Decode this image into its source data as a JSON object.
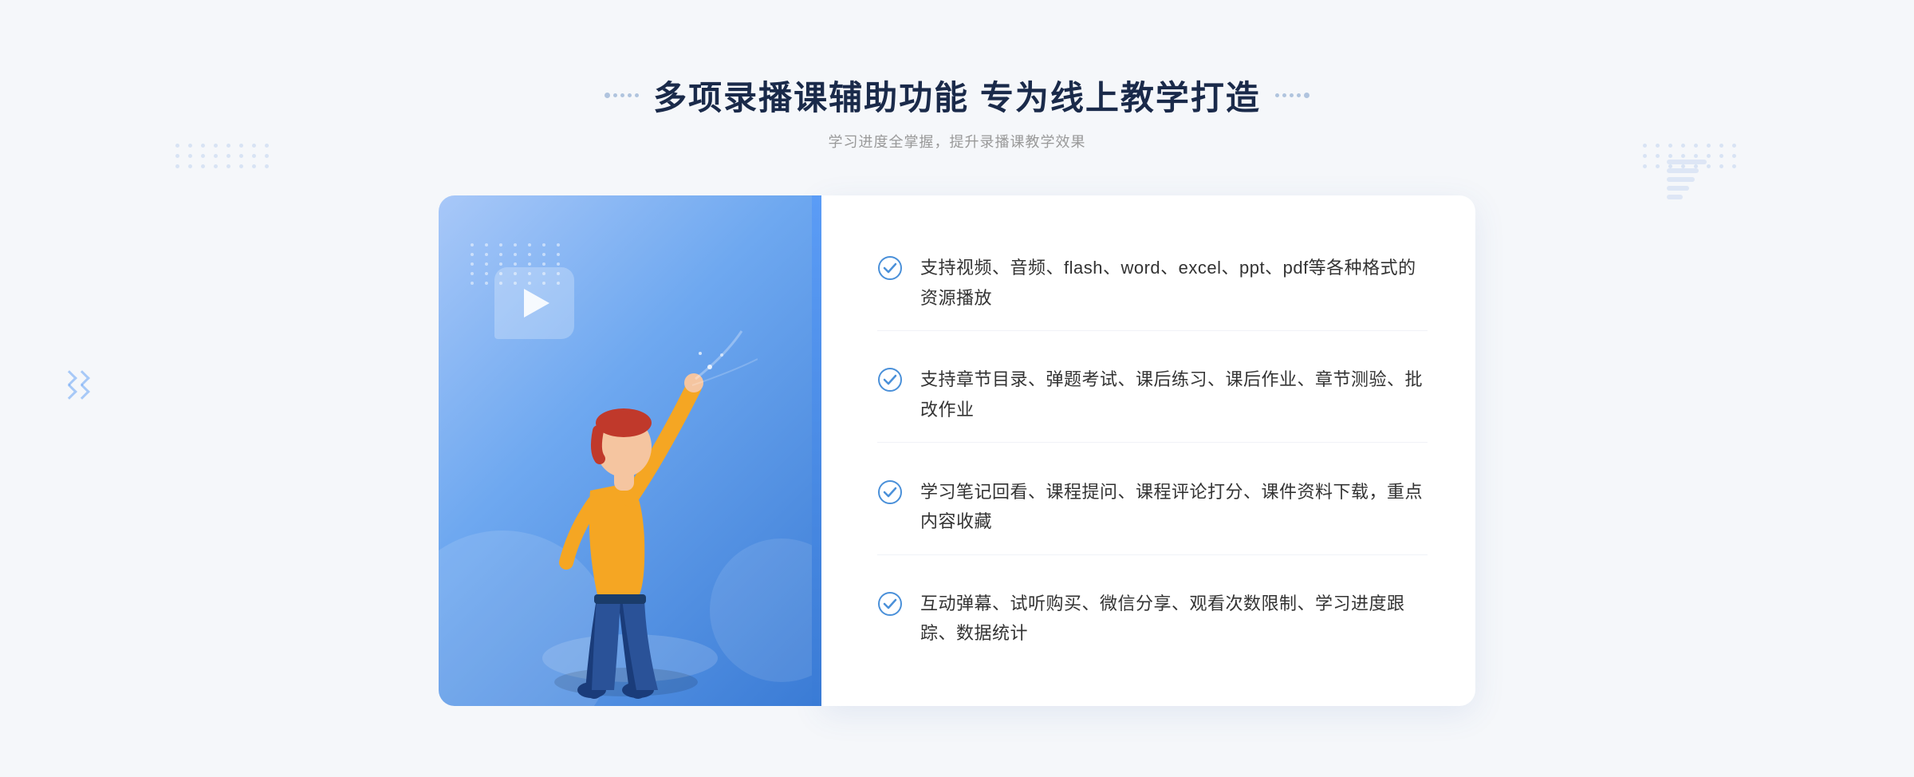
{
  "header": {
    "title": "多项录播课辅助功能 专为线上教学打造",
    "subtitle": "学习进度全掌握，提升录播课教学效果"
  },
  "features": [
    {
      "id": "feature-1",
      "text": "支持视频、音频、flash、word、excel、ppt、pdf等各种格式的资源播放"
    },
    {
      "id": "feature-2",
      "text": "支持章节目录、弹题考试、课后练习、课后作业、章节测验、批改作业"
    },
    {
      "id": "feature-3",
      "text": "学习笔记回看、课程提问、课程评论打分、课件资料下载，重点内容收藏"
    },
    {
      "id": "feature-4",
      "text": "互动弹幕、试听购买、微信分享、观看次数限制、学习进度跟踪、数据统计"
    }
  ],
  "decorative": {
    "title_left_dots": ":::::",
    "title_right_dots": ":::::",
    "chevron_symbol": "»"
  }
}
